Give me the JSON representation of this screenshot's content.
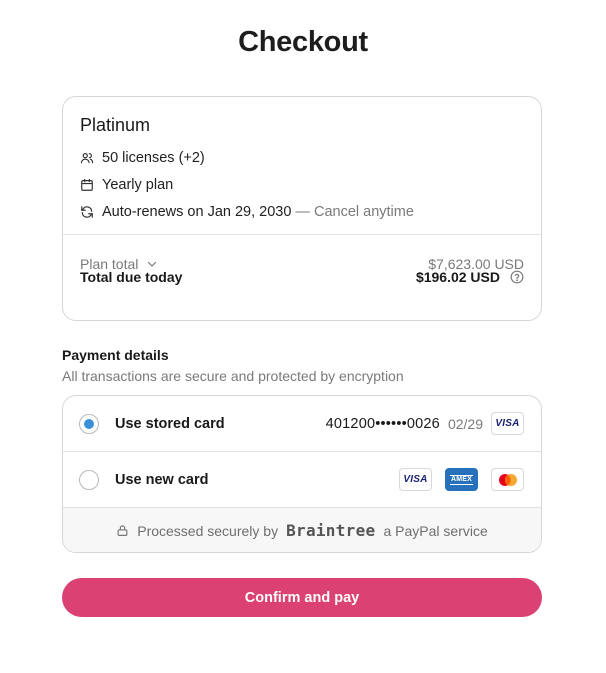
{
  "page": {
    "title": "Checkout"
  },
  "plan": {
    "name": "Platinum",
    "licenses": "50 licenses (+2)",
    "billing": "Yearly plan",
    "renewal": "Auto-renews on Jan 29, 2030",
    "cancel_note": "— Cancel anytime",
    "total_label": "Plan total",
    "total_value": "$7,623.00 USD",
    "due_label": "Total due today",
    "due_value": "$196.02 USD"
  },
  "payment": {
    "heading": "Payment details",
    "subheading": "All transactions are secure and protected by encryption",
    "stored": {
      "label": "Use stored card",
      "number": "401200••••••0026",
      "expiry": "02/29",
      "brand": "VISA",
      "selected": true
    },
    "new_card": {
      "label": "Use new card",
      "brands": [
        "VISA",
        "AMEX",
        "Mastercard"
      ],
      "selected": false
    },
    "secure": {
      "prefix": "Processed securely by",
      "provider": "Braintree",
      "suffix": "a PayPal service"
    }
  },
  "actions": {
    "confirm_label": "Confirm and pay"
  },
  "colors": {
    "accent": "#db4172",
    "radio_selected": "#3a8fd9",
    "muted_text": "#7a7a7a"
  }
}
